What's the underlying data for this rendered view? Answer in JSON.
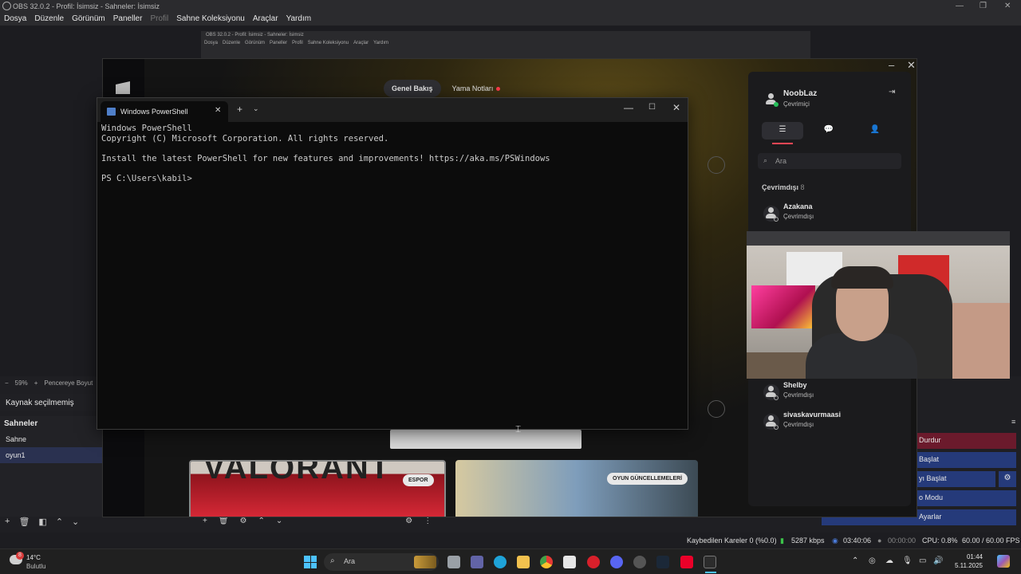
{
  "obs": {
    "title": "OBS 32.0.2 - Profil: İsimsiz - Sahneler: İsimsiz",
    "menu": [
      "Dosya",
      "Düzenle",
      "Görünüm",
      "Paneller",
      "Profil",
      "Sahne Koleksiyonu",
      "Araçlar",
      "Yardım"
    ],
    "zoom": "59%",
    "zoom_fit_label": "Pencereye Boyut",
    "sources_label": "Kaynak seçilmemiş",
    "scenes_header": "Sahneler",
    "scenes": [
      "Sahne",
      "oyun1"
    ],
    "selected_scene": "oyun1",
    "controls": [
      "Durdur",
      "Başlat",
      "yı Başlat",
      "o Modu",
      "Ayarlar"
    ],
    "status": {
      "dropped": "Kaybedilen Kareler 0 (%0.0)",
      "bitrate": "5287 kbps",
      "stream_time": "03:40:06",
      "rec_time": "00:00:00",
      "cpu": "CPU: 0.8%",
      "fps": "60.00 / 60.00 FPS"
    }
  },
  "nested_obs": {
    "title": "OBS 32.0.2 - Profil: İsimsiz - Sahneler: İsimsiz",
    "menu": [
      "Dosya",
      "Düzenle",
      "Görünüm",
      "Paneller",
      "Profil",
      "Sahne Koleksiyonu",
      "Araçlar",
      "Yardım"
    ]
  },
  "riot": {
    "tabs": [
      "Genel Bakış",
      "Yama Notları"
    ],
    "active_tab": "Genel Bakış",
    "card_esports_label": "ESPOR",
    "card_esports_art": "VALORANT",
    "card_updates_label": "OYUN GÜNCELLEMELERİ",
    "accent_color": "#ff4655"
  },
  "social": {
    "user_name": "NoobLaz",
    "user_status": "Çevrimiçi",
    "search_placeholder": "Ara",
    "group_label": "Çevrimdışı",
    "group_count": "8",
    "friends": [
      {
        "name": "Azakana",
        "status": "Çevrimdışı"
      },
      {
        "name": "Shelby",
        "status": "Çevrimdışı"
      },
      {
        "name": "sivaskavurmaasi",
        "status": "Çevrimdışı"
      }
    ]
  },
  "powershell": {
    "tab_title": "Windows PowerShell",
    "lines": [
      "Windows PowerShell",
      "Copyright (C) Microsoft Corporation. All rights reserved.",
      "",
      "Install the latest PowerShell for new features and improvements! https://aka.ms/PSWindows",
      "",
      "PS C:\\Users\\kabil>"
    ]
  },
  "taskbar": {
    "weather_temp": "14°C",
    "weather_desc": "Bulutlu",
    "weather_badge": "8",
    "search_placeholder": "Ara",
    "time": "01:44",
    "date": "5.11.2025"
  }
}
